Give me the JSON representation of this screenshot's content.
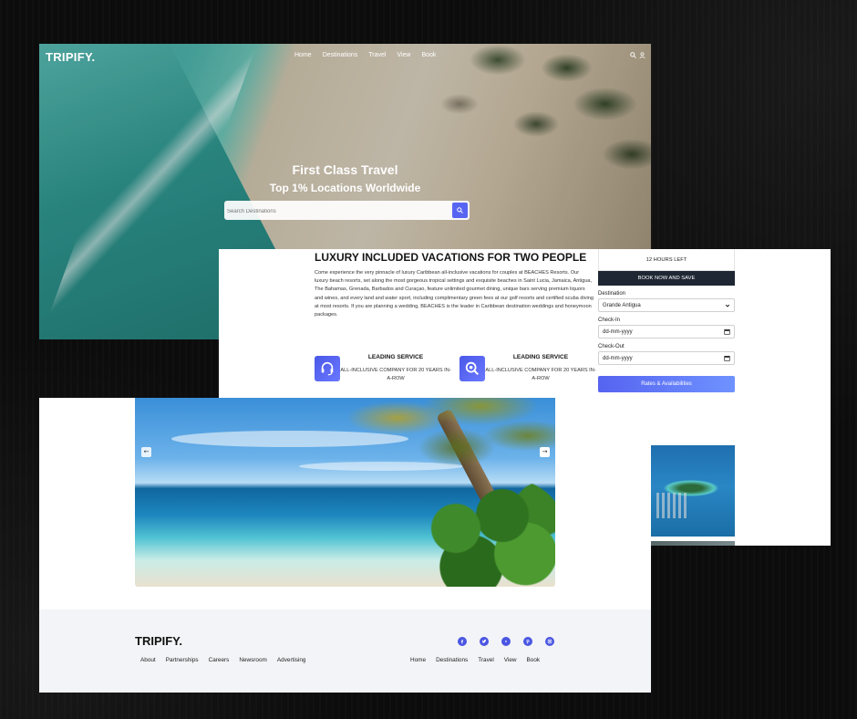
{
  "brand": {
    "logo": "TRIPIFY."
  },
  "hero": {
    "nav": [
      "Home",
      "Destinations",
      "Travel",
      "View",
      "Book"
    ],
    "headline": "First Class Travel",
    "subheadline": "Top 1% Locations Worldwide",
    "search_placeholder": "Search Destinations",
    "icons": [
      "search-icon",
      "user-icon"
    ]
  },
  "content": {
    "title": "LUXURY INCLUDED VACATIONS FOR TWO PEOPLE",
    "description": "Come experience the very pinnacle of luxury Caribbean all-inclusive vacations for couples at BEACHES Resorts. Our luxury beach resorts, set along the most gorgeous tropical settings and exquisite beaches in Saint Lucia, Jamaica, Antigua, The Bahamas, Grenada, Barbados and Curaçao, feature unlimited gourmet dining, unique bars serving premium liquors and wines, and every land and water sport, including complimentary green fees at our golf resorts and certified scuba diving at most resorts. If you are planning a wedding, BEACHES is the leader in Caribbean destination weddings and honeymoon packages.",
    "features": [
      {
        "icon": "headset-icon",
        "heading": "LEADING SERVICE",
        "text": "ALL-INCLUSIVE COMPANY FOR 20 YEARS IN-A-ROW"
      },
      {
        "icon": "search-icon",
        "heading": "LEADING SERVICE",
        "text": "ALL-INCLUSIVE COMPANY FOR 20 YEARS IN-A-ROW"
      }
    ]
  },
  "booking": {
    "timer": "12 HOURS LEFT",
    "cta": "BOOK NOW AND SAVE",
    "destination_label": "Destination",
    "destination_value": "Grande Antigua",
    "checkin_label": "Check-In",
    "checkin_placeholder": "dd-mm-yyyy",
    "checkout_label": "Check-Out",
    "checkout_placeholder": "dd-mm-yyyy",
    "submit": "Rates & Availabilities"
  },
  "carousel": {
    "prev": "←",
    "next": "→"
  },
  "footer": {
    "logo": "TRIPIFY.",
    "links": [
      "About",
      "Partnerships",
      "Careers",
      "Newsroom",
      "Advertising"
    ],
    "nav": [
      "Home",
      "Destinations",
      "Travel",
      "View",
      "Book"
    ],
    "social": [
      "facebook-icon",
      "twitter-icon",
      "youtube-icon",
      "pinterest-icon",
      "instagram-icon"
    ]
  },
  "colors": {
    "accent": "#5865f2",
    "dark": "#1f2734",
    "footer_bg": "#f3f4f7",
    "backdrop": "#0c0c0c"
  }
}
